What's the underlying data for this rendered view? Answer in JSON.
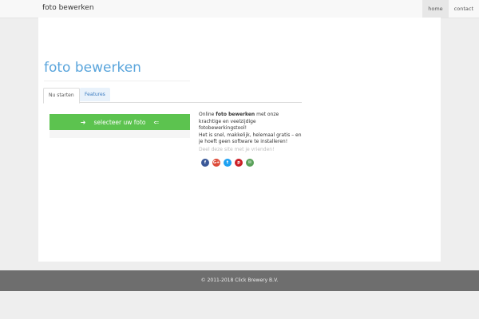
{
  "brand": "foto bewerken",
  "nav": {
    "home": "home",
    "contact": "contact"
  },
  "page": {
    "title": "foto bewerken"
  },
  "tabs": {
    "active": "Nu starten",
    "inactive": "Features"
  },
  "upload": {
    "button_label": "selecteer uw foto",
    "icon_left": "arrow-right-icon",
    "icon_right": "arrow-left-icon"
  },
  "info": {
    "prefix": "Online ",
    "strong": "foto bewerken",
    "rest": " met onze krachtige en veelzijdige fotobewerkingstool!",
    "line2": "Het is snel, makkelijk, helemaal gratis – en je hoeft geen software te installeren!"
  },
  "share": {
    "label": "Deel deze site met je vrienden!",
    "icons": [
      {
        "name": "facebook-icon",
        "glyph": "f",
        "color": "#3b5998"
      },
      {
        "name": "google-plus-icon",
        "glyph": "G+",
        "color": "#dd4b39"
      },
      {
        "name": "twitter-icon",
        "glyph": "t",
        "color": "#1da1f2"
      },
      {
        "name": "pinterest-icon",
        "glyph": "p",
        "color": "#cb2027"
      },
      {
        "name": "email-icon",
        "glyph": "✉",
        "color": "#5aa15a"
      }
    ]
  },
  "footer": {
    "text": "© 2011-2018 Click Brewery B.V."
  },
  "colors": {
    "accent": "#5aa5dc",
    "button": "#5cc34f",
    "footer": "#6e6e6e"
  }
}
